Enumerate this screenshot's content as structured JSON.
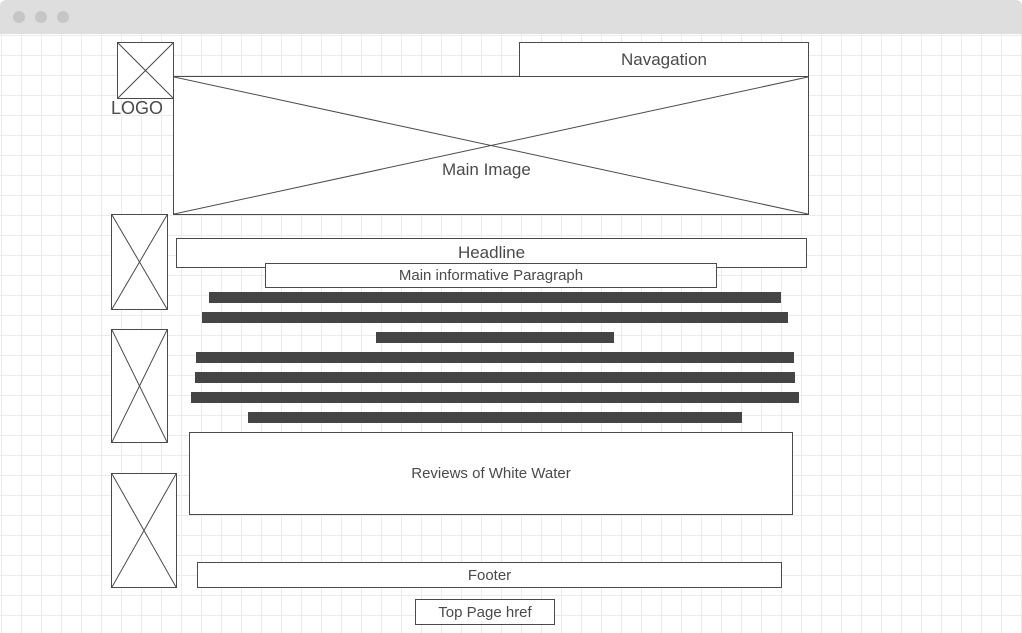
{
  "window": {
    "controls": [
      "close-dot",
      "minimize-dot",
      "zoom-dot"
    ]
  },
  "logo": {
    "label": "LOGO"
  },
  "navigation": {
    "label": "Navagation"
  },
  "main_image": {
    "label": "Main Image"
  },
  "headline": {
    "label": "Headline"
  },
  "paragraph": {
    "label": "Main informative Paragraph",
    "line_count": 7
  },
  "reviews": {
    "label": "Reviews of White Water"
  },
  "footer": {
    "label": "Footer"
  },
  "top_link": {
    "label": "Top Page href"
  },
  "side_images": {
    "count": 3
  },
  "colors": {
    "titlebar": "#dedede",
    "window_dot": "#c6c6c6",
    "stroke": "#4a4a4a",
    "text_bar": "#454545",
    "grid_minor": "#ebebeb",
    "grid_major": "#d9d9d9"
  }
}
